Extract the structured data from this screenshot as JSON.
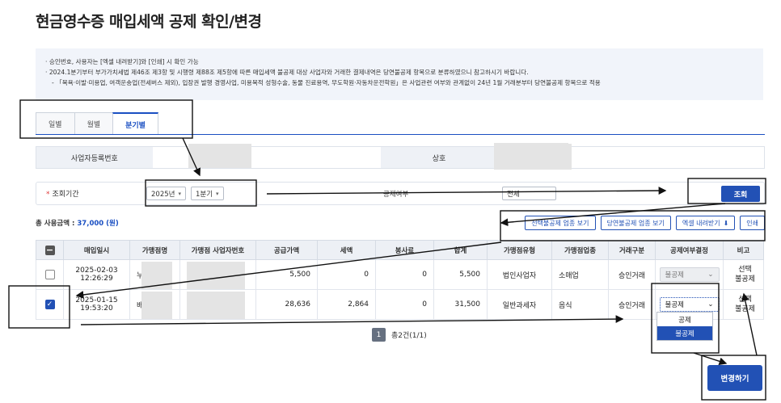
{
  "title": "현금영수증 매입세액 공제 확인/변경",
  "notice": {
    "line1": "· 승인번호, 사용자는 [엑셀 내려받기]와 [인쇄] 시 확인 가능",
    "line2": "· 2024.1분기부터 부가가치세법 제46조 제3항 및 시행령 제88조 제5항에 따른 매입세액 불공제 대상 사업자와 거래한 결제내역은 당연불공제 항목으로 분류하였으니 참고하시기 바랍니다.",
    "line3": "- 「목욕·이발·미용업, 여객운송업(전세버스 제외), 입장권 발행 경영사업, 미용목적 성형수술, 동물 진료용역, 무도학원·자동차운전학원」은 사업관련 여부와 관계없이 24년 1월 거래분부터 당연불공제 항목으로 적용"
  },
  "tabs": [
    {
      "label": "일별",
      "active": false
    },
    {
      "label": "월별",
      "active": false
    },
    {
      "label": "분기별",
      "active": true
    }
  ],
  "info": {
    "bizno_label": "사업자등록번호",
    "name_label": "상호"
  },
  "search": {
    "period_label": "조회기간",
    "year": "2025년",
    "quarter": "1분기",
    "deduct_label": "공제여부",
    "deduct_value": "전체",
    "button": "조회"
  },
  "total": {
    "label": "총 사용금액 :",
    "amount": "37,000 (원)"
  },
  "actions": {
    "selective": "선택불공제 업종 보기",
    "default": "당연불공제 업종 보기",
    "excel": "엑셀 내려받기",
    "print": "인쇄"
  },
  "table": {
    "headers": [
      "",
      "매입일시",
      "가맹점명",
      "가맹점 사업자번호",
      "공급가액",
      "세액",
      "봉사료",
      "합계",
      "가맹점유형",
      "가맹점업종",
      "거래구분",
      "공제여부결정",
      "비고"
    ],
    "rows": [
      {
        "date": "2025-02-03",
        "time": "12:26:29",
        "store": "누",
        "supply": "5,500",
        "tax": "0",
        "service": "0",
        "total": "5,500",
        "type": "법인사업자",
        "industry": "소매업",
        "trade": "승인거래",
        "deduct": "불공제",
        "remark1": "선택",
        "remark2": "불공제",
        "checked": false
      },
      {
        "date": "2025-01-15",
        "time": "19:53:20",
        "store": "배",
        "supply": "28,636",
        "tax": "2,864",
        "service": "0",
        "total": "31,500",
        "type": "일반과세자",
        "industry": "음식",
        "trade": "승인거래",
        "deduct": "불공제",
        "remark1": "선택",
        "remark2": "불공제",
        "checked": true
      }
    ]
  },
  "dropdown": {
    "options": [
      "공제",
      "불공제"
    ],
    "selected": "불공제"
  },
  "pager": {
    "page": "1",
    "count": "총2건(1/1)"
  },
  "change_button": "변경하기"
}
